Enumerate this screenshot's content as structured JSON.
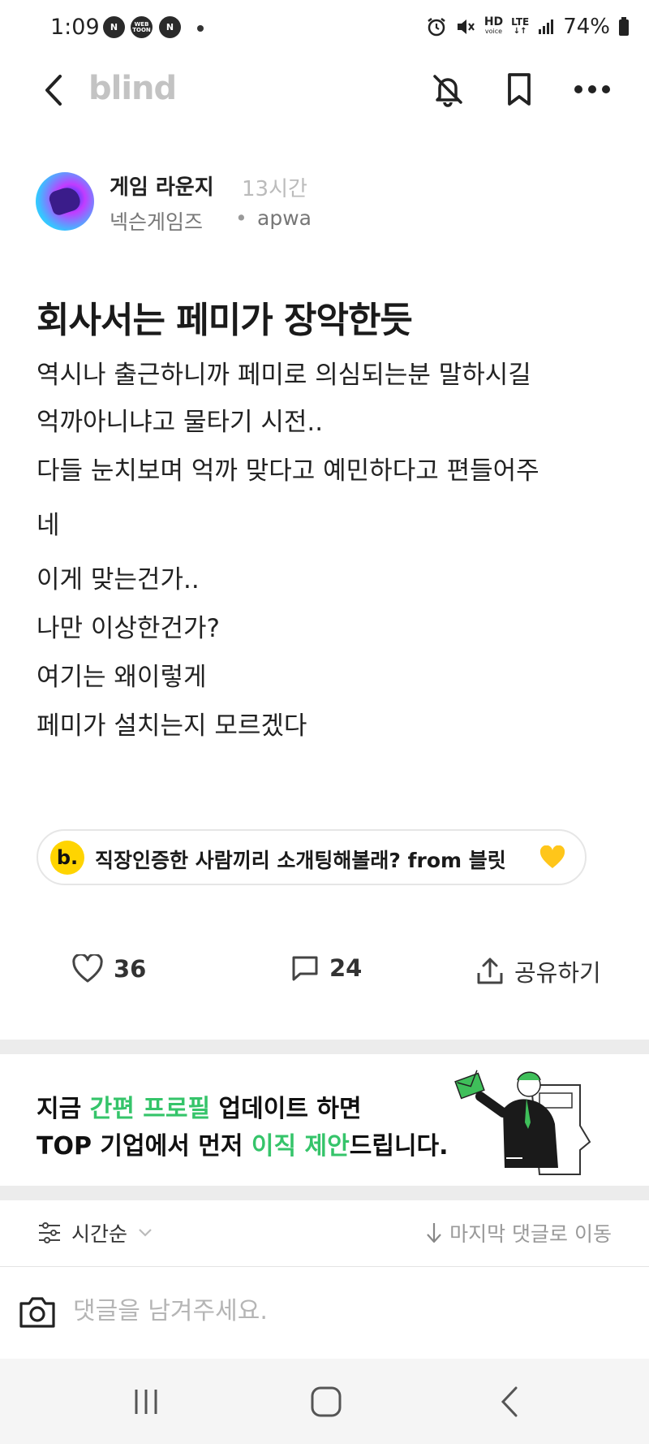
{
  "status_bar": {
    "time": "1:09",
    "badges": [
      "N",
      "WEB TOON",
      "N"
    ],
    "hd_label": "HD",
    "voice_label": "voice",
    "lte_label": "LTE",
    "battery": "74%"
  },
  "nav": {
    "logo": "blind"
  },
  "post": {
    "board": "게임 라운지",
    "time_ago": "13시간",
    "company": "넥슨게임즈",
    "separator": "•",
    "nickname": "apwa",
    "title": "회사서는 페미가 장악한듯",
    "body_lines": [
      "역시나 출근하니까 페미로 의심되는분 말하시길",
      "억까아니냐고 물타기 시전..",
      "다들 눈치보며 억까 맞다고 예민하다고 편들어주",
      "네",
      "이게 맞는건가..",
      "나만 이상한건가?",
      "여기는 왜이렇게",
      "페미가 설치는지 모르겠다"
    ]
  },
  "promo": {
    "badge": "b.",
    "text": "직장인증한 사람끼리 소개팅해볼래? from 블릿"
  },
  "actions": {
    "likes": "36",
    "comments": "24",
    "share_label": "공유하기"
  },
  "ad": {
    "line1_pre": "지금 ",
    "line1_highlight": "간편 프로필",
    "line1_post": " 업데이트 하면",
    "line2_pre": "TOP 기업에서 먼저 ",
    "line2_highlight": "이직 제안",
    "line2_post": "드립니다."
  },
  "sort": {
    "label": "시간순",
    "jump_label": "마지막 댓글로 이동"
  },
  "comment": {
    "placeholder": "댓글을 남겨주세요."
  },
  "colors": {
    "accent_green": "#35c46a",
    "logo_gray": "#c3c3c3",
    "badge_yellow": "#ffd400"
  },
  "icons": [
    "back-arrow-icon",
    "bell-off-icon",
    "bookmark-icon",
    "more-icon",
    "heart-icon",
    "comment-icon",
    "share-icon",
    "sort-icon",
    "chevron-down-icon",
    "arrow-down-icon",
    "camera-icon",
    "recents-icon",
    "home-icon",
    "system-back-icon"
  ]
}
